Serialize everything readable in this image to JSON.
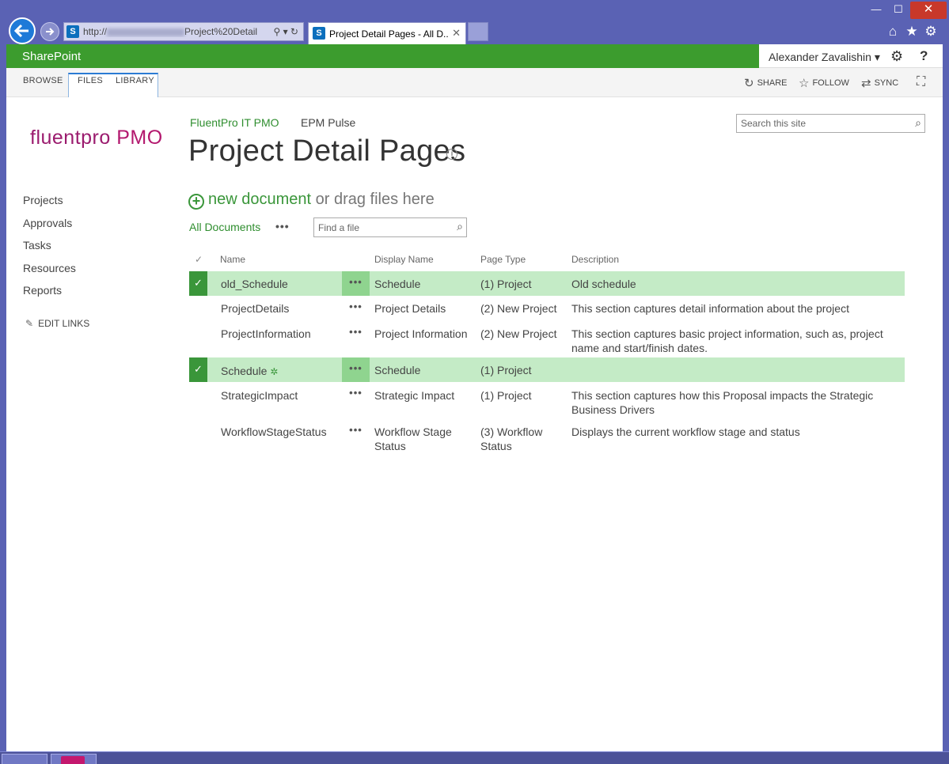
{
  "browser": {
    "address_url_prefix": "http://",
    "address_url_suffix": "Project%20Detail",
    "tab_title": "Project Detail Pages - All D...",
    "window_controls": {
      "minimize": "—",
      "maximize": "☐",
      "close": "✕"
    },
    "address_icons": "⚲ ▾ ↻"
  },
  "suite": {
    "brand": "SharePoint",
    "user_name": "Alexander Zavalishin ▾",
    "settings_icon": "gear-icon",
    "help_label": "?"
  },
  "ribbon": {
    "tabs": [
      "BROWSE",
      "FILES",
      "LIBRARY"
    ],
    "actions": [
      {
        "label": "SHARE",
        "icon": "share-icon"
      },
      {
        "label": "FOLLOW",
        "icon": "star-icon"
      },
      {
        "label": "SYNC",
        "icon": "sync-icon"
      }
    ]
  },
  "logo": {
    "text": "fluentpro",
    "suffix": " PMO"
  },
  "quicklaunch": {
    "items": [
      "Projects",
      "Approvals",
      "Tasks",
      "Resources",
      "Reports"
    ],
    "edit_links": "EDIT LINKS"
  },
  "header": {
    "breadcrumbs": [
      "FluentPro IT PMO",
      "EPM Pulse"
    ],
    "title": "Project Detail Pages",
    "search_placeholder": "Search this site"
  },
  "library": {
    "new_document": "new document",
    "drag_text": " or drag files here",
    "view_name": "All Documents",
    "ellipsis": "•••",
    "find_placeholder": "Find a file",
    "columns": [
      "Name",
      "Display Name",
      "Page Type",
      "Description"
    ],
    "rows": [
      {
        "name": "old_Schedule",
        "display_name": "Schedule",
        "page_type": "(1) Project",
        "description": "Old schedule",
        "selected": true
      },
      {
        "name": "ProjectDetails",
        "display_name": "Project Details",
        "page_type": "(2) New Project",
        "description": "This section captures detail information about the project",
        "selected": false
      },
      {
        "name": "ProjectInformation",
        "display_name": "Project Information",
        "page_type": "(2) New Project",
        "description": "This section captures basic project information, such as, project name and start/finish dates.",
        "selected": false
      },
      {
        "name": "Schedule",
        "display_name": "Schedule",
        "page_type": "(1) Project",
        "description": "",
        "selected": true,
        "new_badge": "✲"
      },
      {
        "name": "StrategicImpact",
        "display_name": "Strategic Impact",
        "page_type": "(1) Project",
        "description": "This section captures how this Proposal impacts the Strategic Business Drivers",
        "selected": false
      },
      {
        "name": "WorkflowStageStatus",
        "display_name": "Workflow Stage Status",
        "page_type": "(3) Workflow Status",
        "description": "Displays the current workflow stage and status",
        "selected": false
      }
    ]
  },
  "colors": {
    "suite_green": "#3c9c2e",
    "link_green": "#2f8e2f",
    "selected_row": "#c4ebc6",
    "browser_frame": "#5a62b4"
  }
}
